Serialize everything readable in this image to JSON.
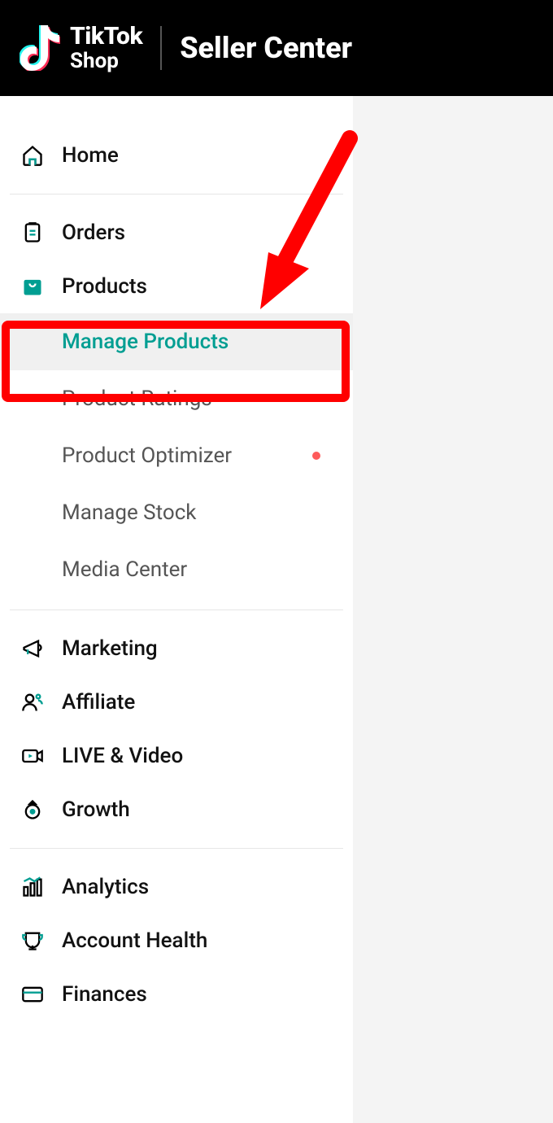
{
  "header": {
    "brand": "TikTok",
    "sub": "Shop",
    "title": "Seller Center"
  },
  "nav": {
    "home": "Home",
    "orders": "Orders",
    "products": "Products",
    "manage_products": "Manage Products",
    "product_ratings": "Product Ratings",
    "product_optimizer": "Product Optimizer",
    "manage_stock": "Manage Stock",
    "media_center": "Media Center",
    "marketing": "Marketing",
    "affiliate": "Affiliate",
    "live_video": "LIVE & Video",
    "growth": "Growth",
    "analytics": "Analytics",
    "account_health": "Account Health",
    "finances": "Finances"
  }
}
